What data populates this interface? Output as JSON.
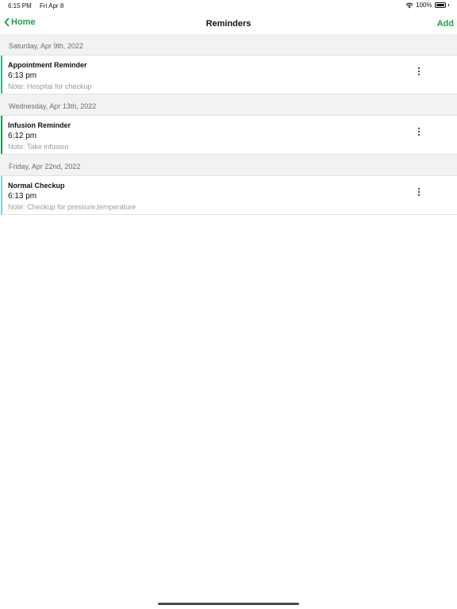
{
  "status_bar": {
    "time": "6:15 PM",
    "date": "Fri Apr 8",
    "battery": "100%",
    "battery_level": 1.0
  },
  "nav": {
    "back_label": "Home",
    "title": "Reminders",
    "add_label": "Add"
  },
  "sections": [
    {
      "header": "Saturday, Apr 9th, 2022",
      "reminder": {
        "title": "Appointment Reminder",
        "time": "6:13 pm",
        "note": "Note: Hospital for checkup",
        "accent_color": "#2bb98a"
      }
    },
    {
      "header": "Wednesday, Apr 13th, 2022",
      "reminder": {
        "title": "Infusion Reminder",
        "time": "6:12 pm",
        "note": "Note: Take infusion",
        "accent_color": "#159a4b"
      }
    },
    {
      "header": "Friday, Apr 22nd, 2022",
      "reminder": {
        "title": "Normal Checkup",
        "time": "6:13 pm",
        "note": "Note: Checkup for pressure,temperature",
        "accent_color": "#7ecfe6"
      }
    }
  ],
  "icons": {
    "back": "chevron-left-icon",
    "more": "more-vertical-icon",
    "wifi": "wifi-icon",
    "battery": "battery-icon"
  },
  "colors": {
    "accent": "#1aa34a",
    "section_bg": "#f2f2f4"
  }
}
